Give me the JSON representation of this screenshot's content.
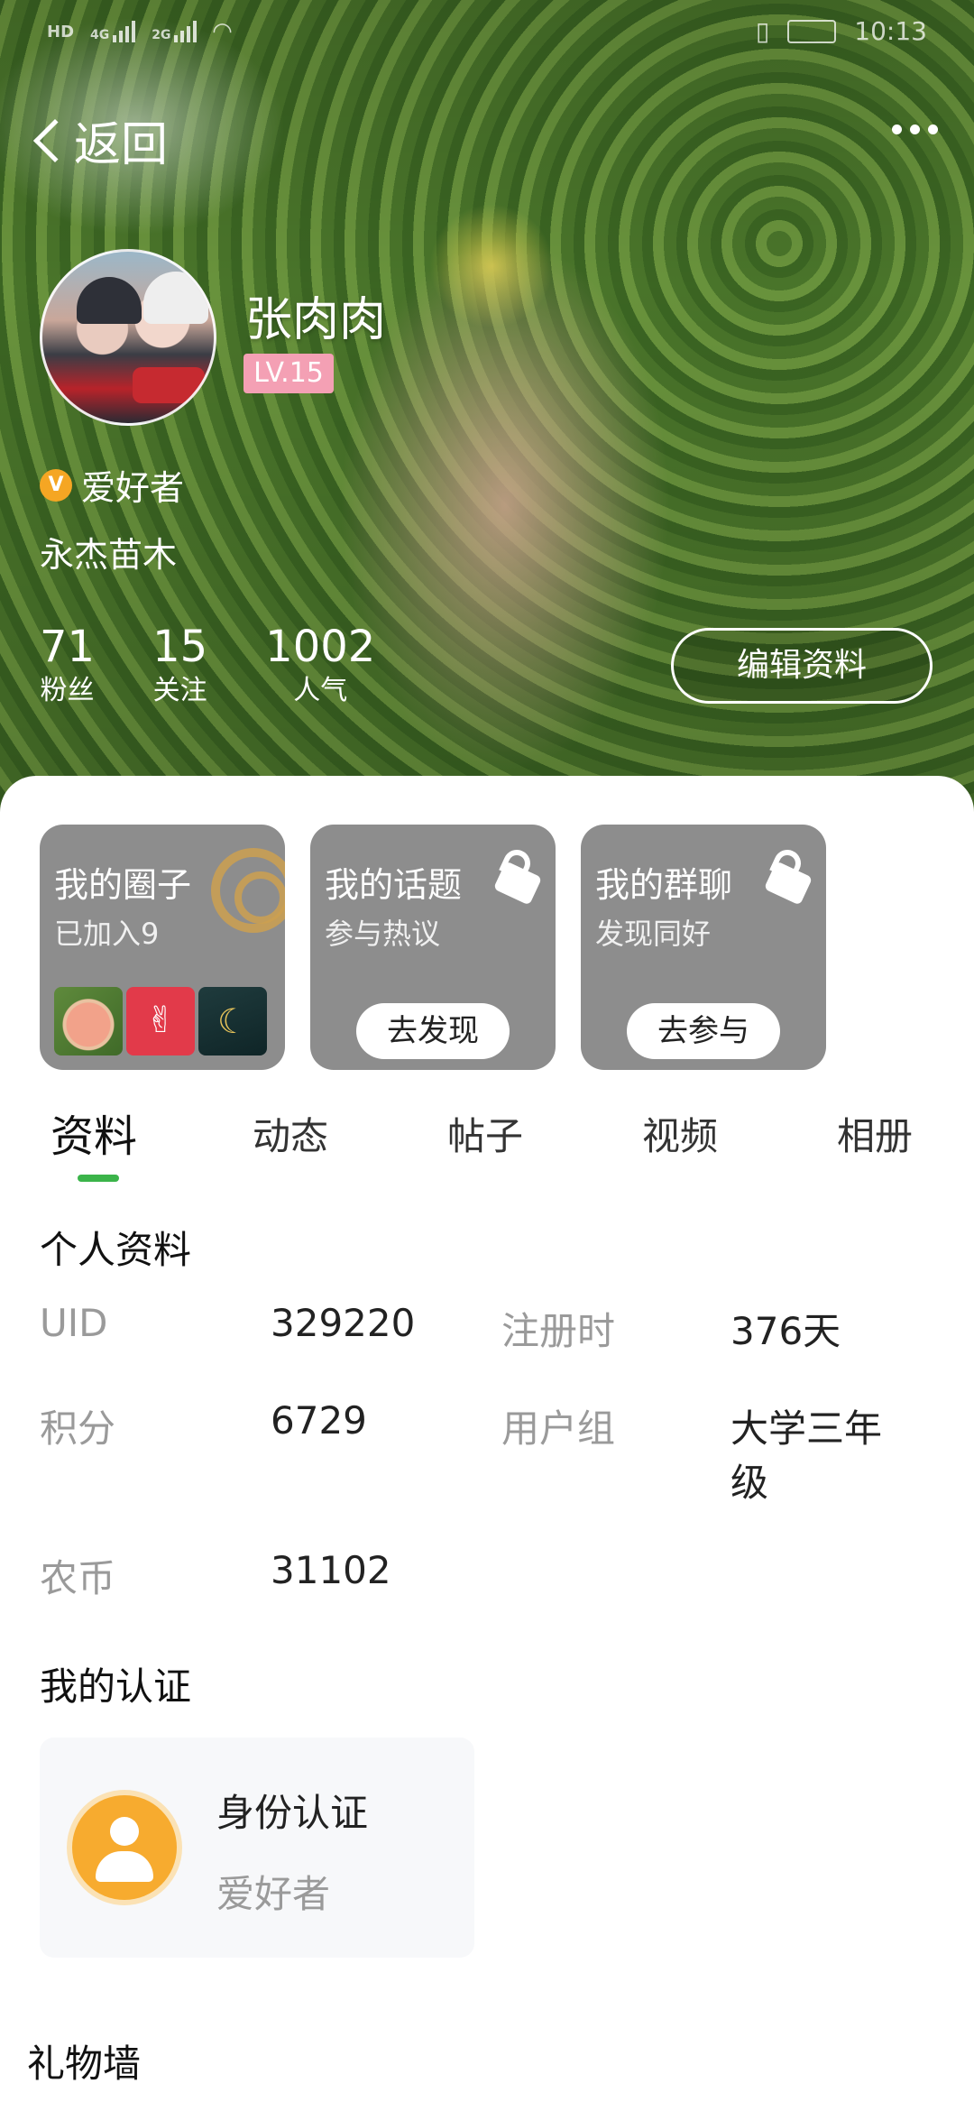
{
  "status": {
    "left_icons": [
      "HD",
      "4G",
      "2G"
    ],
    "time": "10:13"
  },
  "nav": {
    "back_label": "返回"
  },
  "profile": {
    "name": "张肉肉",
    "level": "LV.15",
    "role_badge": "V",
    "role": "爱好者",
    "company": "永杰苗木",
    "stats": [
      {
        "value": "71",
        "label": "粉丝"
      },
      {
        "value": "15",
        "label": "关注"
      },
      {
        "value": "1002",
        "label": "人气"
      }
    ],
    "edit_label": "编辑资料"
  },
  "cards": [
    {
      "title": "我的圈子",
      "subtitle": "已加入9"
    },
    {
      "title": "我的话题",
      "subtitle": "参与热议",
      "button": "去发现"
    },
    {
      "title": "我的群聊",
      "subtitle": "发现同好",
      "button": "去参与"
    }
  ],
  "tabs": [
    "资料",
    "动态",
    "帖子",
    "视频",
    "相册"
  ],
  "personal": {
    "title": "个人资料",
    "uid_key": "UID",
    "uid_val": "329220",
    "reg_key": "注册时",
    "reg_val": "376天",
    "points_key": "积分",
    "points_val": "6729",
    "group_key": "用户组",
    "group_val_line1": "大学三年",
    "group_val_line2": "级",
    "coin_key": "农币",
    "coin_val": "31102"
  },
  "certification": {
    "title": "我的认证",
    "card_title": "身份认证",
    "card_sub": "爱好者"
  },
  "gift_wall": {
    "title": "礼物墙"
  },
  "colors": {
    "accent": "#3bb44a",
    "level_badge": "#f4a0b4",
    "role_badge": "#f5a623",
    "card_bg": "#8d8d8d"
  }
}
